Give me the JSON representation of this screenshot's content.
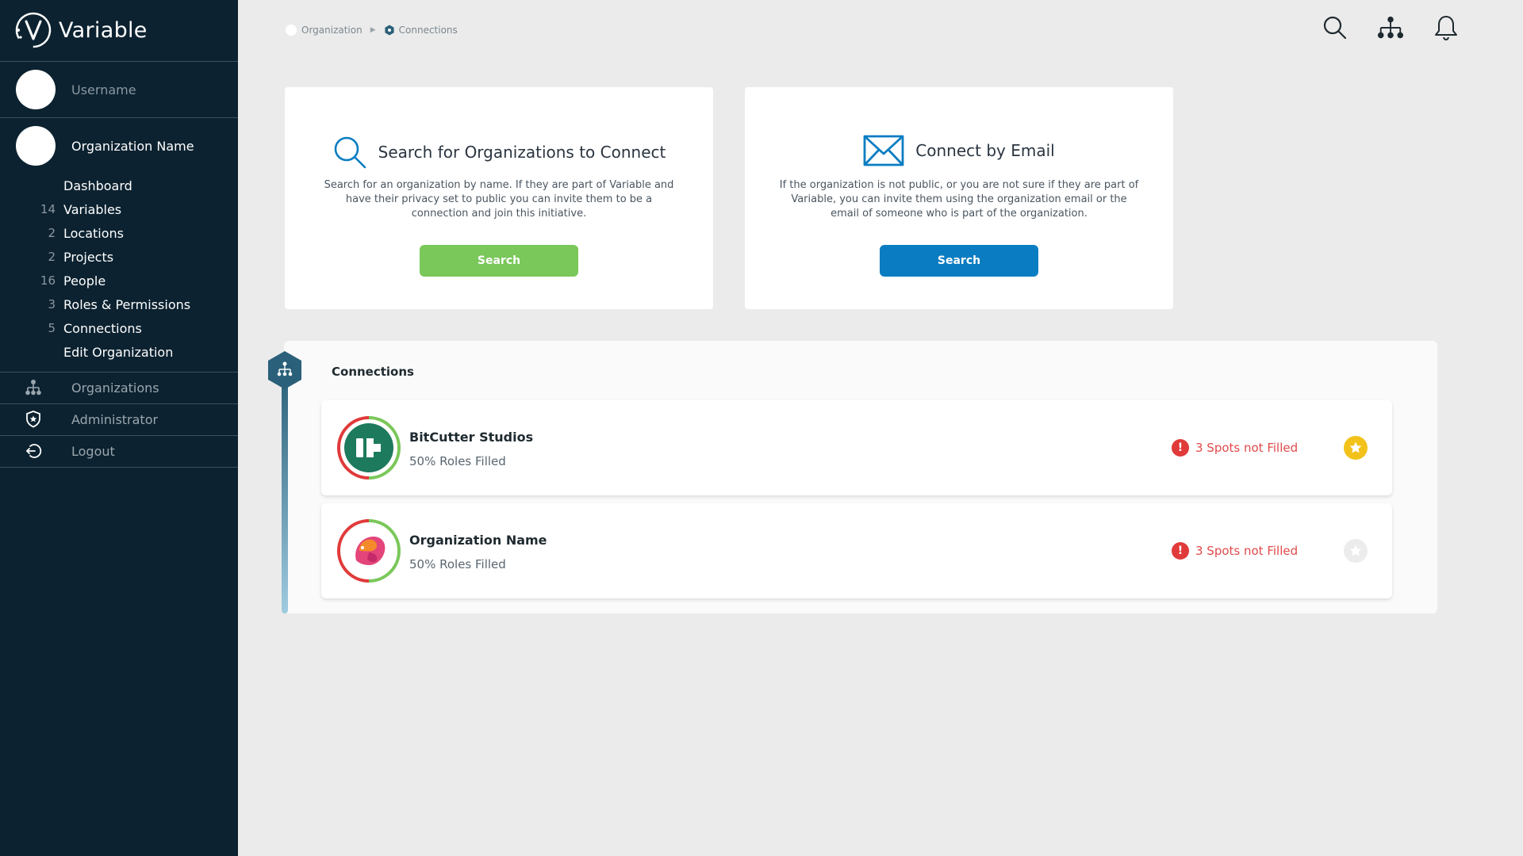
{
  "app": {
    "name": "Variable"
  },
  "sidebar": {
    "username": "Username",
    "org_name": "Organization Name",
    "nav": [
      {
        "count": "",
        "label": "Dashboard"
      },
      {
        "count": "14",
        "label": "Variables"
      },
      {
        "count": "2",
        "label": "Locations"
      },
      {
        "count": "2",
        "label": "Projects"
      },
      {
        "count": "16",
        "label": "People"
      },
      {
        "count": "3",
        "label": "Roles & Permissions"
      },
      {
        "count": "5",
        "label": "Connections"
      },
      {
        "count": "",
        "label": "Edit Organization"
      }
    ],
    "links": [
      {
        "icon": "org-tree-icon",
        "label": "Organizations"
      },
      {
        "icon": "shield-star-icon",
        "label": "Administrator"
      },
      {
        "icon": "logout-icon",
        "label": "Logout"
      }
    ]
  },
  "breadcrumb": {
    "parent": "Organization",
    "current": "Connections"
  },
  "top_icons": [
    "search-icon",
    "org-tree-icon",
    "bell-icon"
  ],
  "cards": {
    "search": {
      "title": "Search for Organizations to Connect",
      "description": "Search for an organization by name.  If they are part of Variable and have their privacy set to public you can invite them to be a connection and join this initiative.",
      "button": "Search",
      "button_color": "#7ac75a"
    },
    "email": {
      "title": "Connect by Email",
      "description": "If the organization is not public, or you are not sure if they are part of Variable, you can invite them using the organization email or the email of someone who is part of the organization.",
      "button": "Search",
      "button_color": "#0a7dc2"
    }
  },
  "connections": {
    "title": "Connections",
    "items": [
      {
        "name": "BitCutter Studios",
        "roles": "50% Roles Filled",
        "status": "3 Spots not Filled",
        "favorite": true
      },
      {
        "name": "Organization Name",
        "roles": "50% Roles Filled",
        "status": "3 Spots not Filled",
        "favorite": false
      }
    ]
  },
  "colors": {
    "sidebar": "#0c2230",
    "accent_blue": "#0a7dc2",
    "accent_green": "#7ac75a",
    "alert_red": "#e03a3a",
    "star_gold": "#f2c21b"
  }
}
